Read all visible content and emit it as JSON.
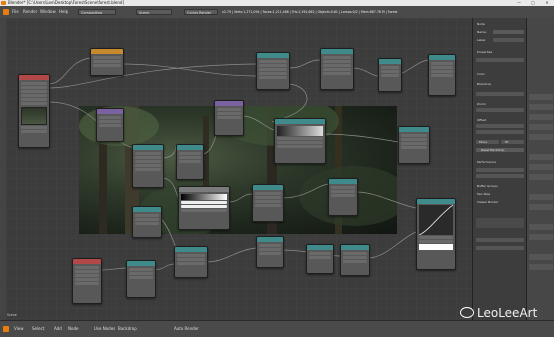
{
  "titlebar": {
    "title": "Blender* [C:\\Users\\Lee\\Desktop\\ForestScene\\forest.blend]",
    "minimize": "—",
    "maximize": "□",
    "close": "✕"
  },
  "header": {
    "menus": [
      "File",
      "Render",
      "Window",
      "Help"
    ],
    "layout": "Compositing",
    "scene": "Scene",
    "engine": "Cycles Render",
    "stats": "v2.79 | Verts:1,271,094 | Faces:1,211,486 | Tris:2,392,662 | Objects:0-61 | Lamps:0/2 | Mem:687.76 M | Forest"
  },
  "footer": {
    "menus": [
      "View",
      "Select",
      "Add",
      "Node"
    ],
    "use_nodes": "Use Nodes",
    "backdrop": "Backdrop",
    "auto_render": "Auto Render"
  },
  "status": "Scene",
  "right_panel": {
    "labels": [
      "Node",
      "Name:",
      "Label:",
      "Properties",
      "Color",
      "Backdrop",
      "Zoom",
      "Offset",
      "Move",
      "Fit",
      "Reset Backdrop",
      "Performance",
      "Buffer Groups",
      "Two Pass",
      "Viewer Border"
    ]
  },
  "watermark": "LeoLeeArt",
  "colors": {
    "accent": "#e87d0d",
    "node_teal": "#3f8a8a",
    "node_orange": "#c68a2e"
  }
}
